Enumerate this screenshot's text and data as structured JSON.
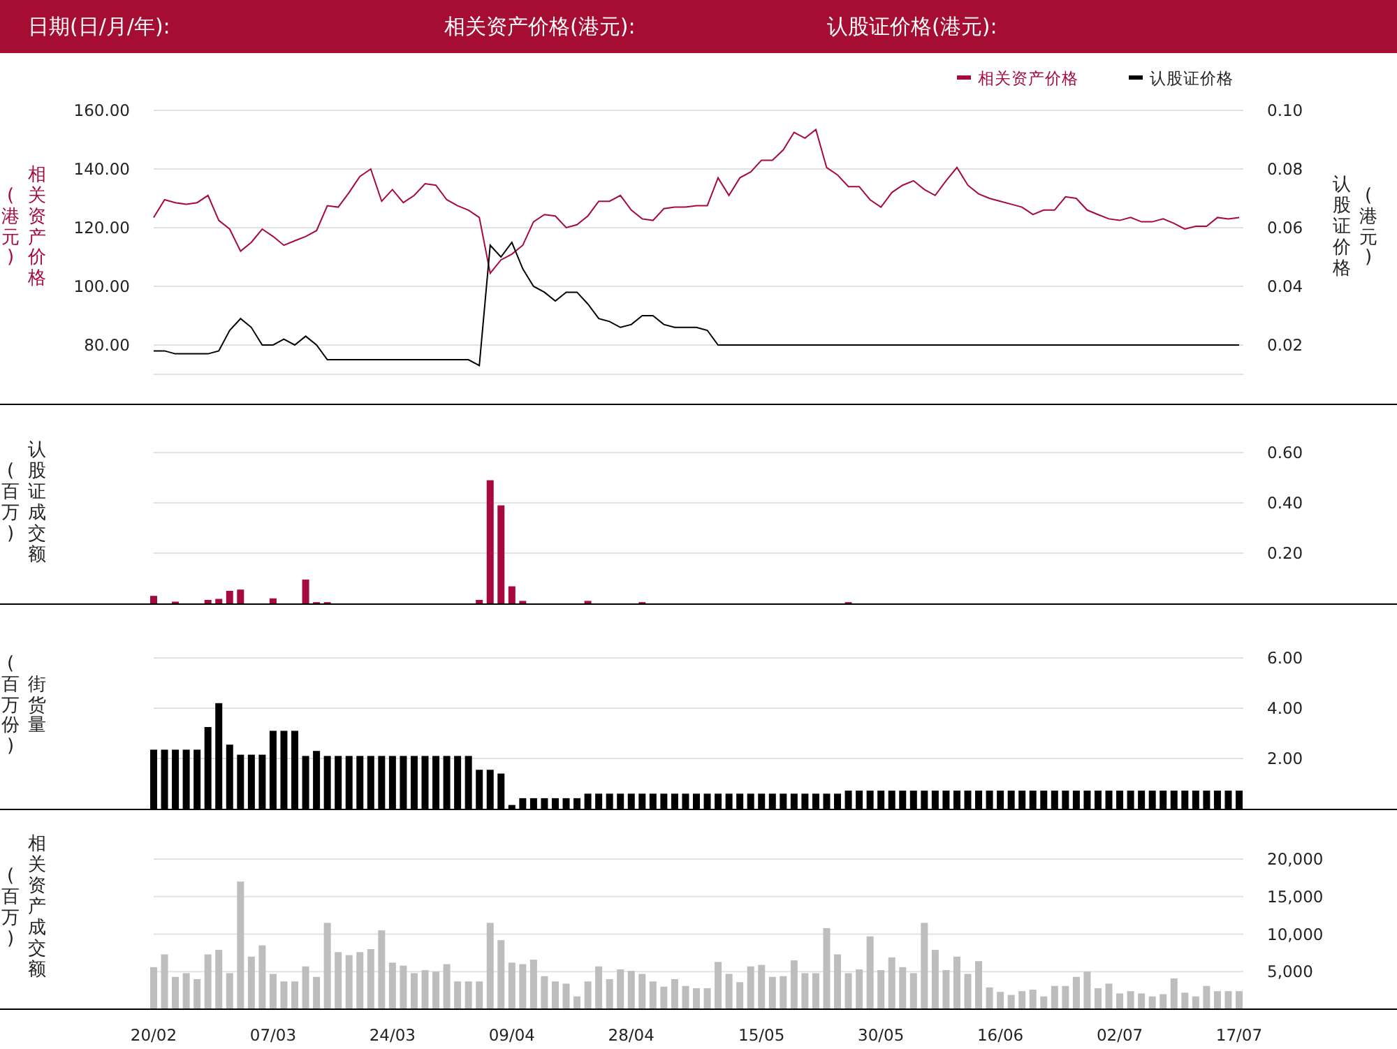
{
  "header": {
    "labels": [
      "日期(日/月/年):",
      "相关资产价格(港元):",
      "认股证价格(港元):"
    ]
  },
  "price_panel": {
    "axis_title": "相关资产价格",
    "axis_unit": "(港元)",
    "right_axis_title": "认股证价格",
    "right_axis_unit": "(港元)",
    "chart_data": {
      "type": "line",
      "categories": [
        null,
        null,
        null,
        null,
        null,
        null,
        null,
        null,
        null,
        null,
        null,
        null,
        null,
        null,
        null,
        null,
        null,
        null,
        null,
        null,
        null,
        null,
        null,
        null,
        null,
        null,
        null,
        null,
        null,
        null,
        null,
        null,
        null,
        null,
        null,
        null,
        null,
        null,
        null,
        null,
        null,
        null,
        null,
        null,
        null,
        null,
        null,
        null,
        null,
        null,
        null,
        null,
        null,
        null,
        null,
        null,
        null,
        null,
        null,
        null,
        null,
        null,
        null,
        null,
        null,
        null,
        null,
        null,
        null,
        null,
        null,
        null,
        null,
        null,
        null,
        null,
        null,
        null,
        null,
        null,
        null,
        null,
        null,
        null,
        null,
        null,
        null,
        null,
        null,
        null,
        null,
        null,
        null,
        null,
        null,
        null,
        null,
        null,
        null,
        null,
        null
      ],
      "grid": true,
      "legend": true,
      "ylim": [
        70,
        160
      ],
      "y2lim": [
        0.01,
        0.1
      ],
      "yticks": [
        {
          "value": 80,
          "label": "80.00"
        },
        {
          "value": 100,
          "label": "100.00"
        },
        {
          "value": 120,
          "label": "120.00"
        },
        {
          "value": 140,
          "label": "140.00"
        },
        {
          "value": 160,
          "label": "160.00"
        }
      ],
      "y2ticks": [
        {
          "value": 0.02,
          "label": "0.02"
        },
        {
          "value": 0.04,
          "label": "0.04"
        },
        {
          "value": 0.06,
          "label": "0.06"
        },
        {
          "value": 0.08,
          "label": "0.08"
        },
        {
          "value": 0.1,
          "label": "0.10"
        }
      ],
      "series": [
        {
          "name": "相关资产价格",
          "color": "#a6093d",
          "values": [
            123.5,
            129.5,
            128.5,
            128,
            128.5,
            131,
            122.5,
            119.5,
            112,
            115,
            119.5,
            117,
            114,
            115.5,
            117,
            119,
            127.5,
            127,
            132,
            137.5,
            140,
            129,
            133,
            128.5,
            131,
            135,
            134.5,
            129.5,
            127.5,
            126,
            123.5,
            104.5,
            109,
            111,
            114,
            122,
            124.5,
            124,
            120,
            121,
            124,
            129,
            129,
            131,
            126,
            123,
            122.5,
            126.5,
            127,
            127,
            127.5,
            127.5,
            137,
            131,
            137,
            139,
            143,
            143,
            146.5,
            152.5,
            150.5,
            153.5,
            140.5,
            138,
            134,
            134,
            129.5,
            127,
            132,
            134.5,
            136,
            133,
            131,
            136,
            140.5,
            134.5,
            131.5,
            130,
            129,
            128,
            127,
            124.5,
            126,
            126,
            130.5,
            130,
            126,
            124.5,
            123,
            122.5,
            123.5,
            122,
            122,
            123,
            121.5,
            119.5,
            120.5,
            120.5,
            123.5,
            123,
            123.5
          ]
        },
        {
          "name": "认股证价格",
          "color": "#000000",
          "axis": "y2",
          "values": [
            0.018,
            0.018,
            0.017,
            0.017,
            0.017,
            0.017,
            0.018,
            0.025,
            0.029,
            0.026,
            0.02,
            0.02,
            0.022,
            0.02,
            0.023,
            0.02,
            0.015,
            0.015,
            0.015,
            0.015,
            0.015,
            0.015,
            0.015,
            0.015,
            0.015,
            0.015,
            0.015,
            0.015,
            0.015,
            0.015,
            0.013,
            0.054,
            0.05,
            0.055,
            0.046,
            0.04,
            0.038,
            0.035,
            0.038,
            0.038,
            0.034,
            0.029,
            0.028,
            0.026,
            0.027,
            0.03,
            0.03,
            0.027,
            0.026,
            0.026,
            0.026,
            0.025,
            0.02,
            0.02,
            0.02,
            0.02,
            0.02,
            0.02,
            0.02,
            0.02,
            0.02,
            0.02,
            0.02,
            0.02,
            0.02,
            0.02,
            0.02,
            0.02,
            0.02,
            0.02,
            0.02,
            0.02,
            0.02,
            0.02,
            0.02,
            0.02,
            0.02,
            0.02,
            0.02,
            0.02,
            0.02,
            0.02,
            0.02,
            0.02,
            0.02,
            0.02,
            0.02,
            0.02,
            0.02,
            0.02,
            0.02,
            0.02,
            0.02,
            0.02,
            0.02,
            0.02,
            0.02,
            0.02,
            0.02,
            0.02,
            0.02
          ]
        }
      ]
    }
  },
  "bar_panels": [
    {
      "axis_title": "认股证成交额",
      "axis_unit": "(百万)",
      "chart_data": {
        "type": "bar",
        "categories": [
          null,
          null,
          null,
          null,
          null,
          null,
          null,
          null,
          null,
          null,
          null,
          null,
          null,
          null,
          null,
          null,
          null,
          null,
          null,
          null,
          null,
          null,
          null,
          null,
          null,
          null,
          null,
          null,
          null,
          null,
          null,
          null,
          null,
          null,
          null,
          null,
          null,
          null,
          null,
          null,
          null,
          null,
          null,
          null,
          null,
          null,
          null,
          null,
          null,
          null,
          null,
          null,
          null,
          null,
          null,
          null,
          null,
          null,
          null,
          null,
          null,
          null,
          null,
          null,
          null,
          null,
          null,
          null,
          null,
          null,
          null,
          null,
          null,
          null,
          null,
          null,
          null,
          null,
          null,
          null,
          null,
          null,
          null,
          null,
          null,
          null,
          null,
          null,
          null,
          null,
          null,
          null,
          null,
          null,
          null,
          null,
          null,
          null,
          null,
          null,
          null
        ],
        "ylim": [
          0,
          0.6
        ],
        "grid": true,
        "yticks": [
          {
            "value": 0.2,
            "label": "0.20"
          },
          {
            "value": 0.4,
            "label": "0.40"
          },
          {
            "value": 0.6,
            "label": "0.60"
          }
        ],
        "series": [
          {
            "color": "#a6093d",
            "values": [
              0.03,
              null,
              0.007,
              null,
              null,
              0.014,
              0.018,
              0.05,
              0.055,
              null,
              null,
              0.02,
              null,
              null,
              0.095,
              0.005,
              0.005,
              null,
              null,
              null,
              null,
              null,
              null,
              null,
              null,
              null,
              null,
              null,
              null,
              null,
              0.014,
              0.49,
              0.39,
              0.068,
              0.01,
              null,
              null,
              null,
              null,
              null,
              0.01,
              null,
              null,
              null,
              null,
              0.005,
              null,
              null,
              null,
              null,
              null,
              null,
              null,
              null,
              null,
              null,
              null,
              null,
              null,
              null,
              null,
              null,
              null,
              null,
              0.005,
              null,
              null,
              null,
              null,
              null,
              null,
              null,
              null,
              null,
              null,
              null,
              null,
              null,
              null,
              null,
              null,
              null,
              null,
              null,
              null,
              null,
              null,
              null,
              null,
              null,
              null,
              null,
              null,
              null,
              null,
              null,
              null,
              null,
              null,
              null,
              null
            ]
          }
        ]
      }
    },
    {
      "axis_title": "街货量",
      "axis_unit": "(百万份)",
      "chart_data": {
        "type": "bar",
        "categories": [
          null,
          null,
          null,
          null,
          null,
          null,
          null,
          null,
          null,
          null,
          null,
          null,
          null,
          null,
          null,
          null,
          null,
          null,
          null,
          null,
          null,
          null,
          null,
          null,
          null,
          null,
          null,
          null,
          null,
          null,
          null,
          null,
          null,
          null,
          null,
          null,
          null,
          null,
          null,
          null,
          null,
          null,
          null,
          null,
          null,
          null,
          null,
          null,
          null,
          null,
          null,
          null,
          null,
          null,
          null,
          null,
          null,
          null,
          null,
          null,
          null,
          null,
          null,
          null,
          null,
          null,
          null,
          null,
          null,
          null,
          null,
          null,
          null,
          null,
          null,
          null,
          null,
          null,
          null,
          null,
          null,
          null,
          null,
          null,
          null,
          null,
          null,
          null,
          null,
          null,
          null,
          null,
          null,
          null,
          null,
          null,
          null,
          null,
          null,
          null,
          null
        ],
        "ylim": [
          0,
          6
        ],
        "grid": true,
        "yticks": [
          {
            "value": 2,
            "label": "2.00"
          },
          {
            "value": 4,
            "label": "4.00"
          },
          {
            "value": 6,
            "label": "6.00"
          }
        ],
        "series": [
          {
            "color": "#000000",
            "values": [
              2.35,
              2.35,
              2.35,
              2.35,
              2.35,
              3.25,
              4.2,
              2.55,
              2.15,
              2.15,
              2.15,
              3.1,
              3.1,
              3.1,
              2.1,
              2.3,
              2.1,
              2.1,
              2.1,
              2.1,
              2.1,
              2.1,
              2.1,
              2.1,
              2.1,
              2.1,
              2.1,
              2.1,
              2.1,
              2.1,
              1.55,
              1.55,
              1.4,
              0.15,
              0.42,
              0.42,
              0.42,
              0.42,
              0.42,
              0.42,
              0.6,
              0.6,
              0.6,
              0.6,
              0.6,
              0.6,
              0.6,
              0.6,
              0.6,
              0.6,
              0.6,
              0.6,
              0.6,
              0.6,
              0.6,
              0.6,
              0.6,
              0.6,
              0.6,
              0.6,
              0.6,
              0.6,
              0.6,
              0.6,
              0.72,
              0.72,
              0.72,
              0.72,
              0.72,
              0.72,
              0.72,
              0.72,
              0.72,
              0.72,
              0.72,
              0.72,
              0.72,
              0.72,
              0.72,
              0.72,
              0.72,
              0.72,
              0.72,
              0.72,
              0.72,
              0.72,
              0.72,
              0.72,
              0.72,
              0.72,
              0.72,
              0.72,
              0.72,
              0.72,
              0.72,
              0.72,
              0.72,
              0.72,
              0.72,
              0.72,
              0.72
            ]
          }
        ]
      }
    },
    {
      "axis_title": "相关资产成交额",
      "axis_unit": "(百万)",
      "chart_data": {
        "type": "bar",
        "categories": [
          "20/02",
          null,
          null,
          null,
          null,
          null,
          null,
          null,
          null,
          null,
          null,
          "07/03",
          null,
          null,
          null,
          null,
          null,
          null,
          null,
          null,
          null,
          null,
          "24/03",
          null,
          null,
          null,
          null,
          null,
          null,
          null,
          null,
          null,
          null,
          "09/04",
          null,
          null,
          null,
          null,
          null,
          null,
          null,
          null,
          null,
          null,
          "28/04",
          null,
          null,
          null,
          null,
          null,
          null,
          null,
          null,
          null,
          null,
          null,
          "15/05",
          null,
          null,
          null,
          null,
          null,
          null,
          null,
          null,
          null,
          null,
          "30/05",
          null,
          null,
          null,
          null,
          null,
          null,
          null,
          null,
          null,
          null,
          "16/06",
          null,
          null,
          null,
          null,
          null,
          null,
          null,
          null,
          null,
          null,
          "02/07",
          null,
          null,
          null,
          null,
          null,
          null,
          null,
          null,
          null,
          null,
          "17/07"
        ],
        "ylim": [
          0,
          20000
        ],
        "grid": true,
        "yticks": [
          {
            "value": 5000,
            "label": "5,000"
          },
          {
            "value": 10000,
            "label": "10,000"
          },
          {
            "value": 15000,
            "label": "15,000"
          },
          {
            "value": 20000,
            "label": "20,000"
          }
        ],
        "series": [
          {
            "color": "#bdbdbd",
            "values": [
              5600,
              7300,
              4300,
              4800,
              4000,
              7300,
              7900,
              4800,
              17000,
              7000,
              8500,
              4700,
              3700,
              3700,
              5700,
              4300,
              11500,
              7600,
              7200,
              7600,
              8000,
              10500,
              6200,
              5800,
              4800,
              5200,
              5000,
              6000,
              3700,
              3700,
              3700,
              11500,
              9200,
              6200,
              6000,
              6600,
              4400,
              3700,
              3400,
              1700,
              3700,
              5700,
              4000,
              5300,
              5100,
              4700,
              3700,
              3000,
              4000,
              3100,
              2800,
              2800,
              6300,
              4700,
              3600,
              5700,
              5900,
              4300,
              4400,
              6500,
              4800,
              4800,
              10800,
              7300,
              4800,
              5300,
              9700,
              5200,
              6900,
              5600,
              4800,
              11500,
              7900,
              5200,
              7000,
              4700,
              6400,
              2900,
              2300,
              1900,
              2400,
              2600,
              1700,
              3100,
              3100,
              4300,
              5000,
              2800,
              3400,
              2100,
              2400,
              2100,
              1700,
              2000,
              4100,
              2200,
              1700,
              3100,
              2400,
              2400,
              2400
            ]
          }
        ]
      }
    }
  ]
}
